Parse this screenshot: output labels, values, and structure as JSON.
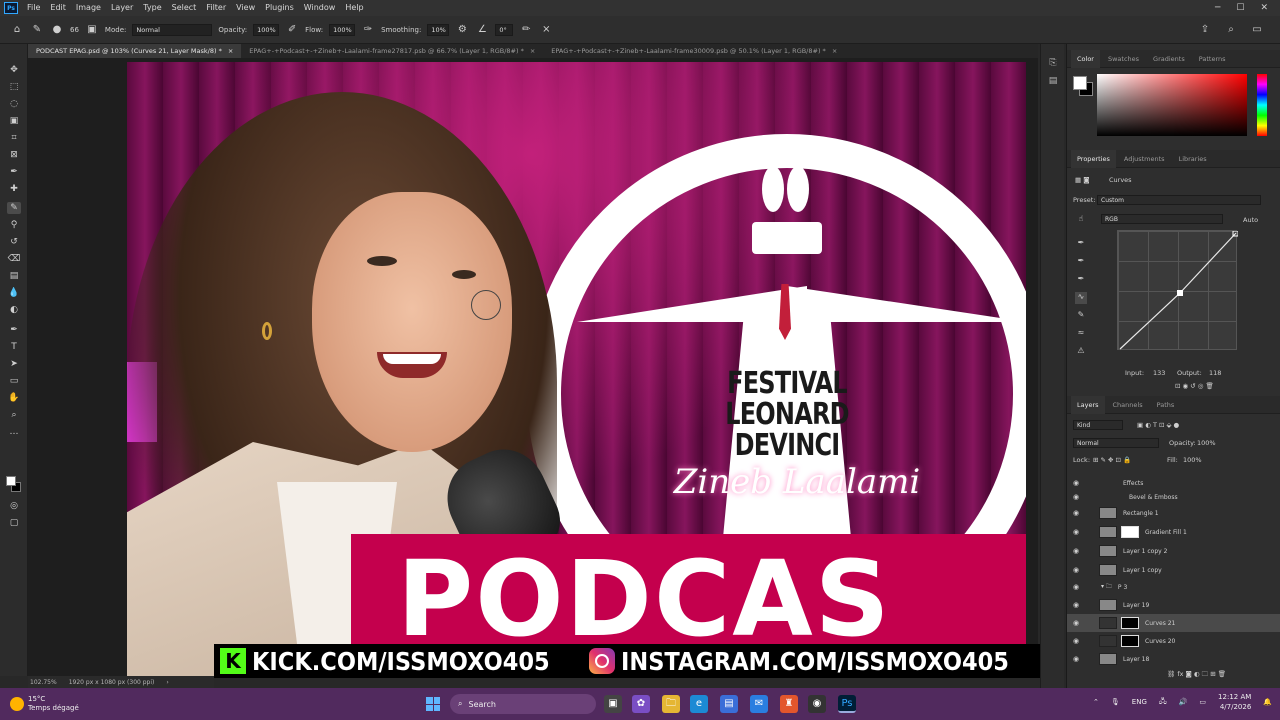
{
  "menu": {
    "logo": "Ps",
    "items": [
      "File",
      "Edit",
      "Image",
      "Layer",
      "Type",
      "Select",
      "Filter",
      "View",
      "Plugins",
      "Window",
      "Help"
    ]
  },
  "options": {
    "brush_size": "66",
    "mode_label": "Mode:",
    "mode_value": "Normal",
    "opacity_label": "Opacity:",
    "opacity_value": "100%",
    "flow_label": "Flow:",
    "flow_value": "100%",
    "smoothing_label": "Smoothing:",
    "smoothing_value": "10%",
    "angle_value": "0°"
  },
  "tabs": [
    {
      "label": "PODCAST EPAG.psd @ 103% (Curves 21, Layer Mask/8) *",
      "close": "×"
    },
    {
      "label": "EPAG+-+Podcast+-+Zineb+-Laalami-frame27817.psb @ 66.7% (Layer 1, RGB/8#) *",
      "close": "×"
    },
    {
      "label": "EPAG+-+Podcast+-+Zineb+-Laalami-frame30009.psb @ 50.1% (Layer 1, RGB/8#) *",
      "close": "×"
    }
  ],
  "artwork": {
    "festival_lines": [
      "FESTIVAL",
      "LEONARD",
      "DEVINCI"
    ],
    "name": "Zineb Laalami",
    "podcast": "PODCAS"
  },
  "banner": {
    "kick_letter": "K",
    "kick_text": "KICK.COM/ISSMOXO405",
    "insta_text": "INSTAGRAM.COM/ISSMOXO405"
  },
  "status": {
    "zoom": "102.75%",
    "size": "1920 px x 1080 px (300 ppi)"
  },
  "color_panel": {
    "tabs": [
      "Color",
      "Swatches",
      "Gradients",
      "Patterns"
    ]
  },
  "properties": {
    "tabs": [
      "Properties",
      "Adjustments",
      "Libraries"
    ],
    "title": "Curves",
    "preset_label": "Preset:",
    "preset_value": "Custom",
    "channel": "RGB",
    "auto": "Auto",
    "input_label": "Input:",
    "input_value": "133",
    "output_label": "Output:",
    "output_value": "118"
  },
  "layers": {
    "tabs": [
      "Layers",
      "Channels",
      "Paths"
    ],
    "kind": "Kind",
    "blend": "Normal",
    "opacity_label": "Opacity:",
    "opacity_value": "100%",
    "lock_label": "Lock:",
    "fill_label": "Fill:",
    "fill_value": "100%",
    "rows": [
      {
        "name": "Effects"
      },
      {
        "name": "Bevel & Emboss"
      },
      {
        "name": "Rectangle 1"
      },
      {
        "name": "Gradient Fill 1"
      },
      {
        "name": "Layer 1 copy 2"
      },
      {
        "name": "Layer 1 copy"
      },
      {
        "name": "P 3"
      },
      {
        "name": "Layer 19"
      },
      {
        "name": "Curves 21"
      },
      {
        "name": "Curves 20"
      },
      {
        "name": "Layer 18"
      }
    ]
  },
  "taskbar": {
    "temp": "15°C",
    "weather": "Temps dégagé",
    "search": "Search",
    "lang": "ENG",
    "time": "12:12 AM",
    "date": "4/7/2026"
  }
}
